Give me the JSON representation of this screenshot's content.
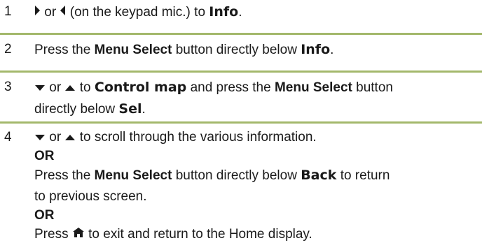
{
  "steps": [
    {
      "number": "1",
      "icon_right": "right-arrow-icon",
      "or": "or",
      "icon_left": "left-arrow-icon",
      "text_a": "(on the keypad mic.) to",
      "display_info": "Info",
      "end": "."
    },
    {
      "number": "2",
      "text_a": "Press the",
      "menu_select": "Menu Select",
      "text_b": "button directly below",
      "display_info": "Info",
      "end": "."
    },
    {
      "number": "3",
      "icon_down": "down-arrow-icon",
      "or": "or",
      "icon_up": "up-arrow-icon",
      "text_a": "to",
      "display_control_map": "Control map",
      "text_b": "and press the",
      "menu_select": "Menu Select",
      "text_c": "button",
      "text_d": "directly below",
      "display_sel": "Sel",
      "end": "."
    },
    {
      "number": "4",
      "icon_down": "down-arrow-icon",
      "or": "or",
      "icon_up": "up-arrow-icon",
      "text_a": "to scroll through the various information.",
      "or_1": "OR",
      "text_b": "Press the",
      "menu_select": "Menu Select",
      "text_c": "button directly below",
      "display_back": "Back",
      "text_d": "to return",
      "text_e": "to previous screen.",
      "or_2": "OR",
      "text_f": "Press",
      "icon_home": "home-icon",
      "text_g": "to exit and return to the Home display."
    }
  ],
  "colors": {
    "rule": "#a3b86b",
    "text": "#1a1a1a"
  }
}
